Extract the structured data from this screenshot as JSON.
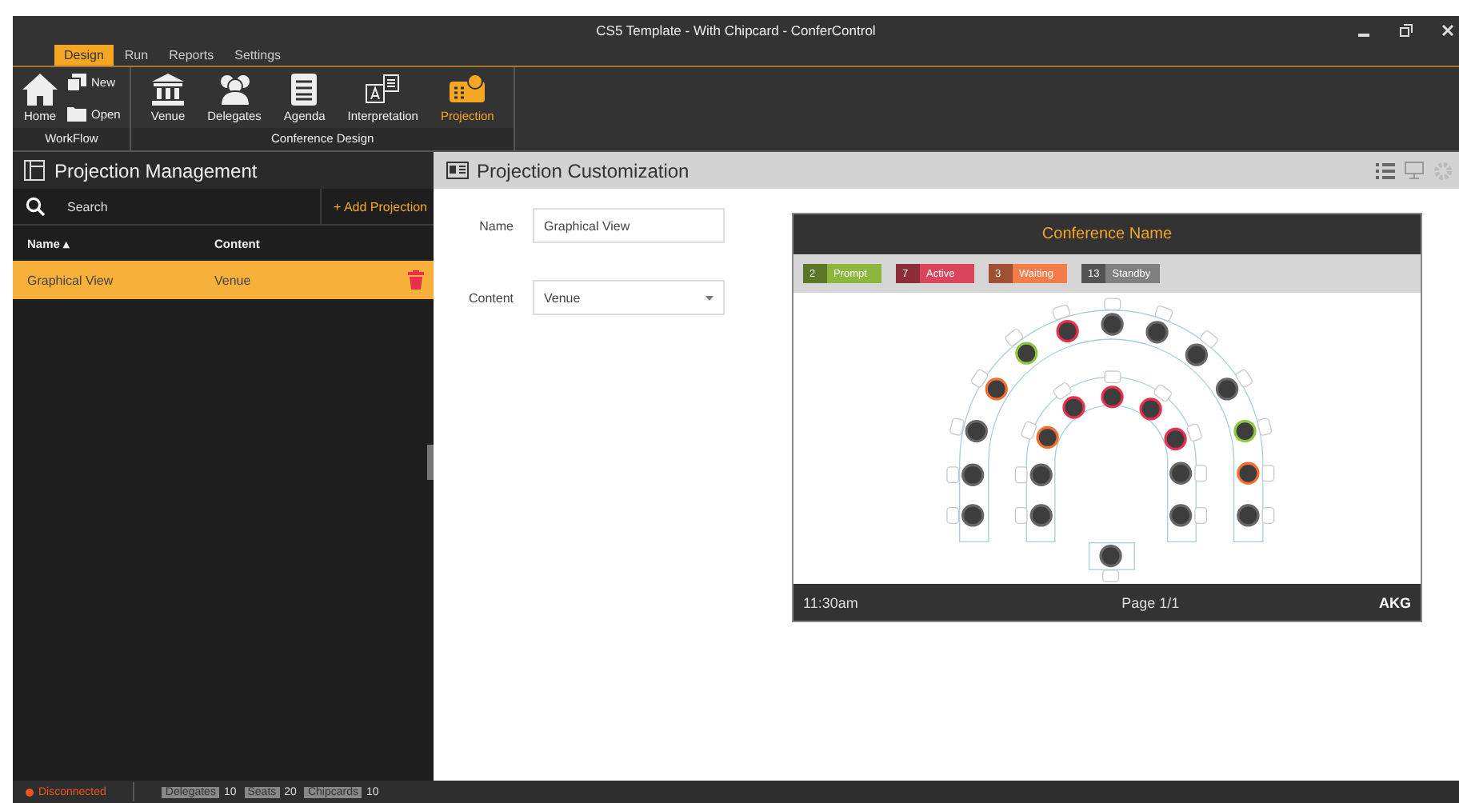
{
  "window": {
    "title": "CS5 Template - With Chipcard - ConferControl"
  },
  "tabs": [
    {
      "label": "Design",
      "selected": true
    },
    {
      "label": "Run",
      "selected": false
    },
    {
      "label": "Reports",
      "selected": false
    },
    {
      "label": "Settings",
      "selected": false
    }
  ],
  "ribbon": {
    "groups": [
      {
        "label": "WorkFlow",
        "items": [
          {
            "kind": "home",
            "label": "Home",
            "selected": false
          },
          {
            "kind": "new",
            "label": "New",
            "selected": false
          },
          {
            "kind": "open",
            "label": "Open",
            "selected": false
          }
        ]
      },
      {
        "label": "Conference Design",
        "items": [
          {
            "kind": "venue",
            "label": "Venue",
            "selected": false
          },
          {
            "kind": "delegates",
            "label": "Delegates",
            "selected": false
          },
          {
            "kind": "agenda",
            "label": "Agenda",
            "selected": false
          },
          {
            "kind": "interpretation",
            "label": "Interpretation",
            "selected": false
          },
          {
            "kind": "projection",
            "label": "Projection",
            "selected": true
          }
        ]
      }
    ]
  },
  "left_panel": {
    "title": "Projection Management",
    "search": {
      "placeholder": "Search"
    },
    "add_button": "+ Add Projection",
    "columns": [
      "Name ▴",
      "Content"
    ],
    "rows": [
      {
        "name": "Graphical View",
        "content": "Venue",
        "selected": true
      }
    ]
  },
  "right_panel": {
    "title": "Projection Customization",
    "form": {
      "name_label": "Name",
      "name_value": "Graphical View",
      "content_label": "Content",
      "content_value": "Venue"
    },
    "preview": {
      "title": "Conference Name",
      "legend": [
        {
          "count": "2",
          "label": "Prompt",
          "color": "#8cb63c"
        },
        {
          "count": "7",
          "label": "Active",
          "color": "#d9455a"
        },
        {
          "count": "3",
          "label": "Waiting",
          "color": "#f47c4a"
        },
        {
          "count": "13",
          "label": "Standby",
          "color": "#808080"
        }
      ],
      "seats": [
        {
          "color": "#666666"
        },
        {
          "color": "#666666"
        },
        {
          "color": "#666666"
        },
        {
          "color": "#f26f30"
        },
        {
          "color": "#8dc63f"
        },
        {
          "color": "#e8304e"
        },
        {
          "color": "#666666"
        },
        {
          "color": "#666666"
        },
        {
          "color": "#666666"
        },
        {
          "color": "#666666"
        },
        {
          "color": "#8dc63f"
        },
        {
          "color": "#f26f30"
        },
        {
          "color": "#666666"
        },
        {
          "color": "#666666"
        },
        {
          "color": "#666666"
        },
        {
          "color": "#f26f30"
        },
        {
          "color": "#e8304e"
        },
        {
          "color": "#e8304e"
        },
        {
          "color": "#e8304e"
        },
        {
          "color": "#e8304e"
        },
        {
          "color": "#666666"
        },
        {
          "color": "#666666"
        },
        {
          "color": "#666666"
        }
      ],
      "time": "11:30am",
      "page": "Page 1/1",
      "logo": "AKG"
    }
  },
  "status_bar": {
    "connection": "Disconnected",
    "counts": [
      {
        "label": "Delegates",
        "value": "10"
      },
      {
        "label": "Seats",
        "value": "20"
      },
      {
        "label": "Chipcards",
        "value": "10"
      }
    ]
  }
}
